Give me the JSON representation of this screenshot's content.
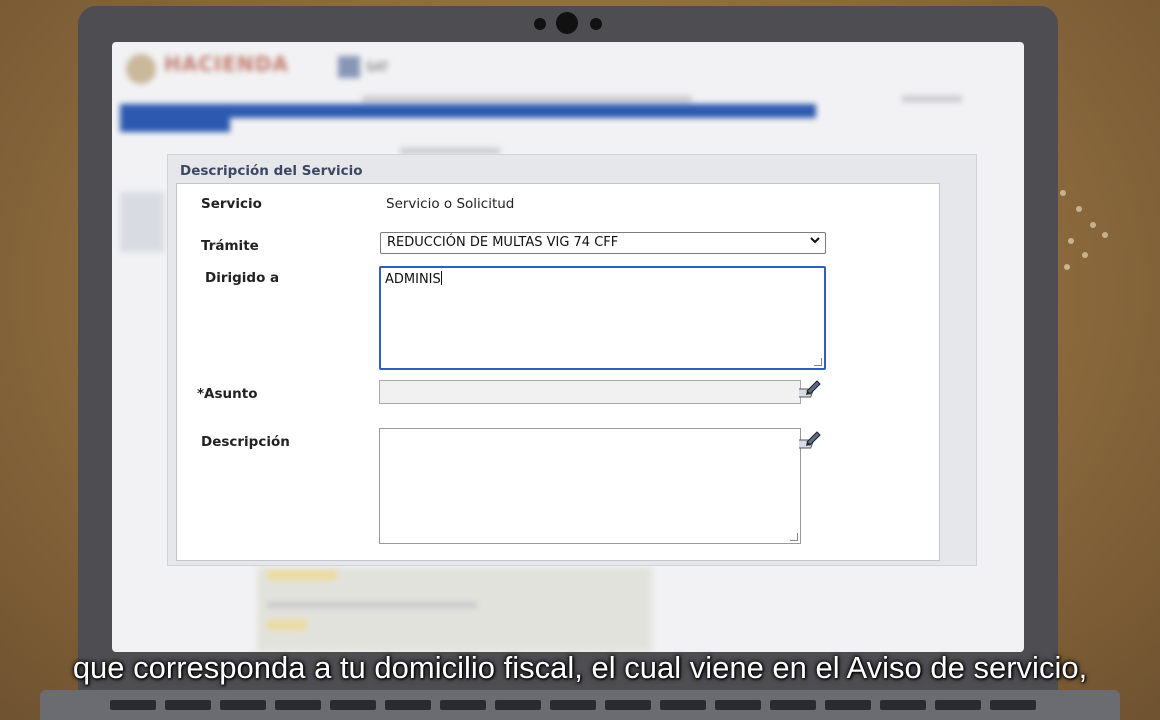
{
  "form": {
    "section_title": "Descripción del Servicio",
    "servicio_label": "Servicio",
    "servicio_value": "Servicio o Solicitud",
    "tramite_label": "Trámite",
    "tramite_selected": "REDUCCIÓN DE MULTAS VIG 74 CFF",
    "dirigido_label": "Dirigido a",
    "dirigido_value": "ADMINIS",
    "asunto_label": "*Asunto",
    "asunto_value": "",
    "descripcion_label": "Descripción",
    "descripcion_value": ""
  },
  "icons": {
    "select_arrow": "chevron-down-icon",
    "edit": "pencil-edit-icon"
  },
  "subtitle": "que corresponda a tu domicilio fiscal, el cual viene en el Aviso de servicio,",
  "colors": {
    "background": "#8c6b3d",
    "focus_border": "#2f5fb6",
    "section_title": "#3c4763"
  }
}
